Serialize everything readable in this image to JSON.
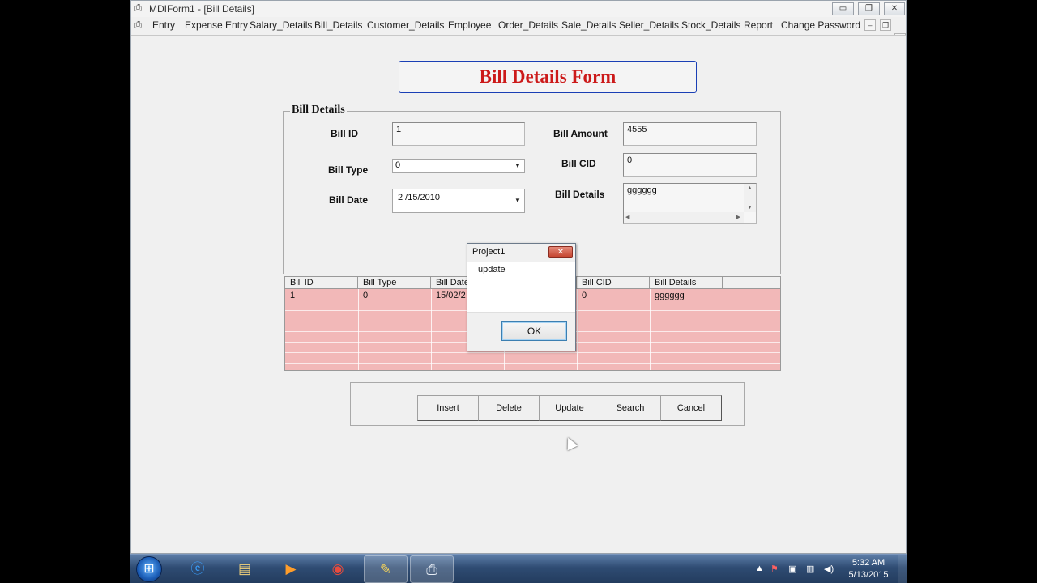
{
  "window": {
    "title": "MDIForm1 - [Bill Details]",
    "controls": {
      "minimize": "▭",
      "restore": "❐",
      "close": "✕"
    }
  },
  "menu": {
    "items": [
      "Entry",
      "Expense Entry",
      "Salary_Details",
      "Bill_Details",
      "Customer_Details",
      "Employee",
      "Order_Details",
      "Sale_Details",
      "Seller_Details",
      "Stock_Details",
      "Report",
      "Change Password"
    ],
    "mdi_controls": {
      "minimize": "–",
      "restore": "❐",
      "close": "✕"
    }
  },
  "form": {
    "title": "Bill Details Form",
    "frame_caption": "Bill Details",
    "fields": {
      "bill_id": {
        "label": "Bill ID",
        "value": "1"
      },
      "bill_type": {
        "label": "Bill Type",
        "value": "0"
      },
      "bill_date": {
        "label": "Bill Date",
        "value": "2 /15/2010"
      },
      "bill_amount": {
        "label": "Bill Amount",
        "value": "4555"
      },
      "bill_cid": {
        "label": "Bill CID",
        "value": "0"
      },
      "bill_details": {
        "label": "Bill Details",
        "value": "gggggg"
      }
    }
  },
  "grid": {
    "columns": [
      "Bill ID",
      "Bill Type",
      "Bill Date",
      "",
      "Bill CID",
      "Bill Details",
      ""
    ],
    "rows": [
      [
        "1",
        "0",
        "15/02/2",
        "",
        "0",
        "gggggg",
        ""
      ]
    ]
  },
  "buttons": {
    "insert": "Insert",
    "delete": "Delete",
    "update": "Update",
    "search": "Search",
    "cancel": "Cancel"
  },
  "msgbox": {
    "title": "Project1",
    "text": "update",
    "ok": "OK",
    "close": "✕"
  },
  "taskbar": {
    "time": "5:32 AM",
    "date": "5/13/2015"
  }
}
